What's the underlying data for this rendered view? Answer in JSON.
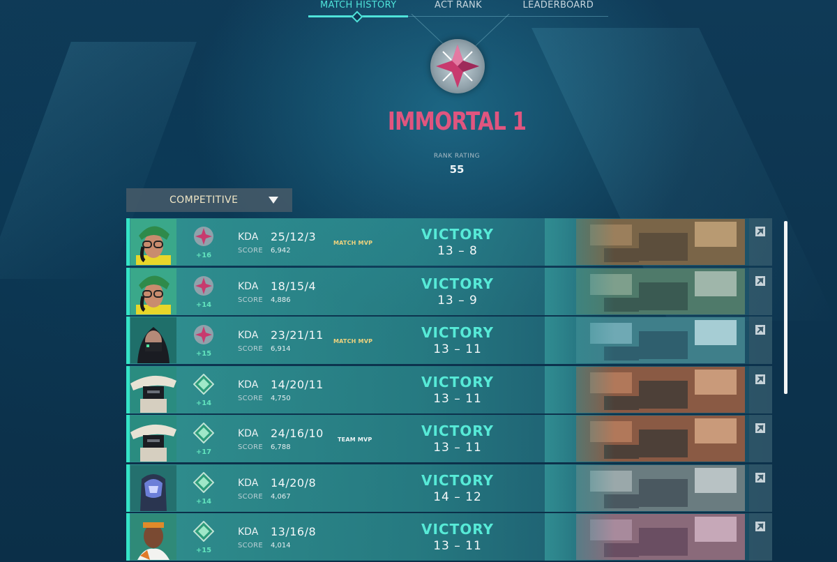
{
  "nav": {
    "tabs": [
      {
        "label": "MATCH HISTORY",
        "active": true
      },
      {
        "label": "ACT RANK",
        "active": false
      },
      {
        "label": "LEADERBOARD",
        "active": false
      }
    ]
  },
  "rank": {
    "title": "IMMORTAL 1",
    "rating_label": "RANK RATING",
    "rating_value": "55"
  },
  "mode_dropdown": {
    "selected": "COMPETITIVE"
  },
  "colors": {
    "accent": "#4fe3da",
    "immortal": "#e0557f",
    "victory": "#57ead7",
    "rr_gain": "#62e3bd",
    "match_mvp": "#f0d37d"
  },
  "matches": [
    {
      "agent": "killjoy",
      "rank_icon": "immortal",
      "rr": "+16",
      "kda_label": "KDA",
      "kda": "25/12/3",
      "score_label": "SCORE",
      "score": "6,942",
      "mvp": "MATCH MVP",
      "result": "VICTORY",
      "round_score": "13 – 8",
      "map": "map-1"
    },
    {
      "agent": "killjoy",
      "rank_icon": "immortal",
      "rr": "+14",
      "kda_label": "KDA",
      "kda": "18/15/4",
      "score_label": "SCORE",
      "score": "4,886",
      "mvp": "",
      "result": "VICTORY",
      "round_score": "13 – 9",
      "map": "map-2"
    },
    {
      "agent": "viper",
      "rank_icon": "immortal",
      "rr": "+15",
      "kda_label": "KDA",
      "kda": "23/21/11",
      "score_label": "SCORE",
      "score": "6,914",
      "mvp": "MATCH MVP",
      "result": "VICTORY",
      "round_score": "13 – 11",
      "map": "map-3"
    },
    {
      "agent": "cypher",
      "rank_icon": "ascendant",
      "rr": "+14",
      "kda_label": "KDA",
      "kda": "14/20/11",
      "score_label": "SCORE",
      "score": "4,750",
      "mvp": "",
      "result": "VICTORY",
      "round_score": "13 – 11",
      "map": "map-4"
    },
    {
      "agent": "cypher",
      "rank_icon": "ascendant",
      "rr": "+17",
      "kda_label": "KDA",
      "kda": "24/16/10",
      "score_label": "SCORE",
      "score": "6,788",
      "mvp": "TEAM MVP",
      "result": "VICTORY",
      "round_score": "13 – 11",
      "map": "map-4"
    },
    {
      "agent": "kayo",
      "rank_icon": "ascendant",
      "rr": "+14",
      "kda_label": "KDA",
      "kda": "14/20/8",
      "score_label": "SCORE",
      "score": "4,067",
      "mvp": "",
      "result": "VICTORY",
      "round_score": "14 – 12",
      "map": "map-5"
    },
    {
      "agent": "phoenix",
      "rank_icon": "ascendant",
      "rr": "+15",
      "kda_label": "KDA",
      "kda": "13/16/8",
      "score_label": "SCORE",
      "score": "4,014",
      "mvp": "",
      "result": "VICTORY",
      "round_score": "13 – 11",
      "map": "map-6"
    }
  ]
}
